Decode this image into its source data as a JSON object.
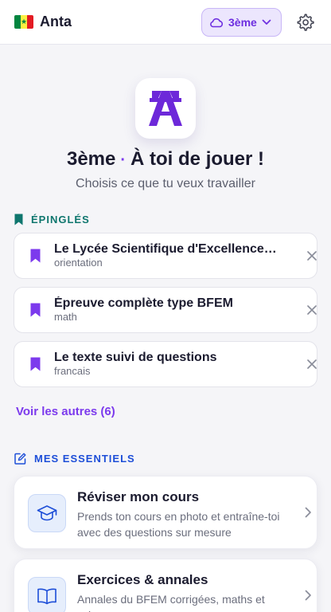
{
  "header": {
    "app_name": "Anta",
    "flag_icon": "senegal-flag-icon",
    "grade_label": "3ème",
    "cloud_icon": "cloud-icon",
    "settings_icon": "gear-icon"
  },
  "hero": {
    "grade": "3ème",
    "dot": "·",
    "title": "À toi de jouer !",
    "subtitle": "Choisis ce que tu veux travailler"
  },
  "pinned": {
    "heading": "ÉPINGLÉS",
    "items": [
      {
        "title": "Le Lycée Scientifique d'Excellence de Diourbel",
        "subject": "orientation"
      },
      {
        "title": "Épreuve complète type BFEM",
        "subject": "math"
      },
      {
        "title": "Le texte suivi de questions",
        "subject": "francais"
      }
    ],
    "see_more": "Voir les autres (6)"
  },
  "essentials": {
    "heading": "MES ESSENTIELS",
    "cards": [
      {
        "title": "Réviser mon cours",
        "desc": "Prends ton cours en photo et entraîne-toi avec des questions sur mesure",
        "icon": "graduation-cap-icon"
      },
      {
        "title": "Exercices & annales",
        "desc": "Annales du BFEM corrigées, maths et sciences",
        "icon": "open-book-icon"
      }
    ]
  },
  "colors": {
    "accent": "#7c3aed",
    "pinned_heading": "#0f766e",
    "essentials_heading": "#1d4ed8",
    "background": "#f5f5f8"
  }
}
